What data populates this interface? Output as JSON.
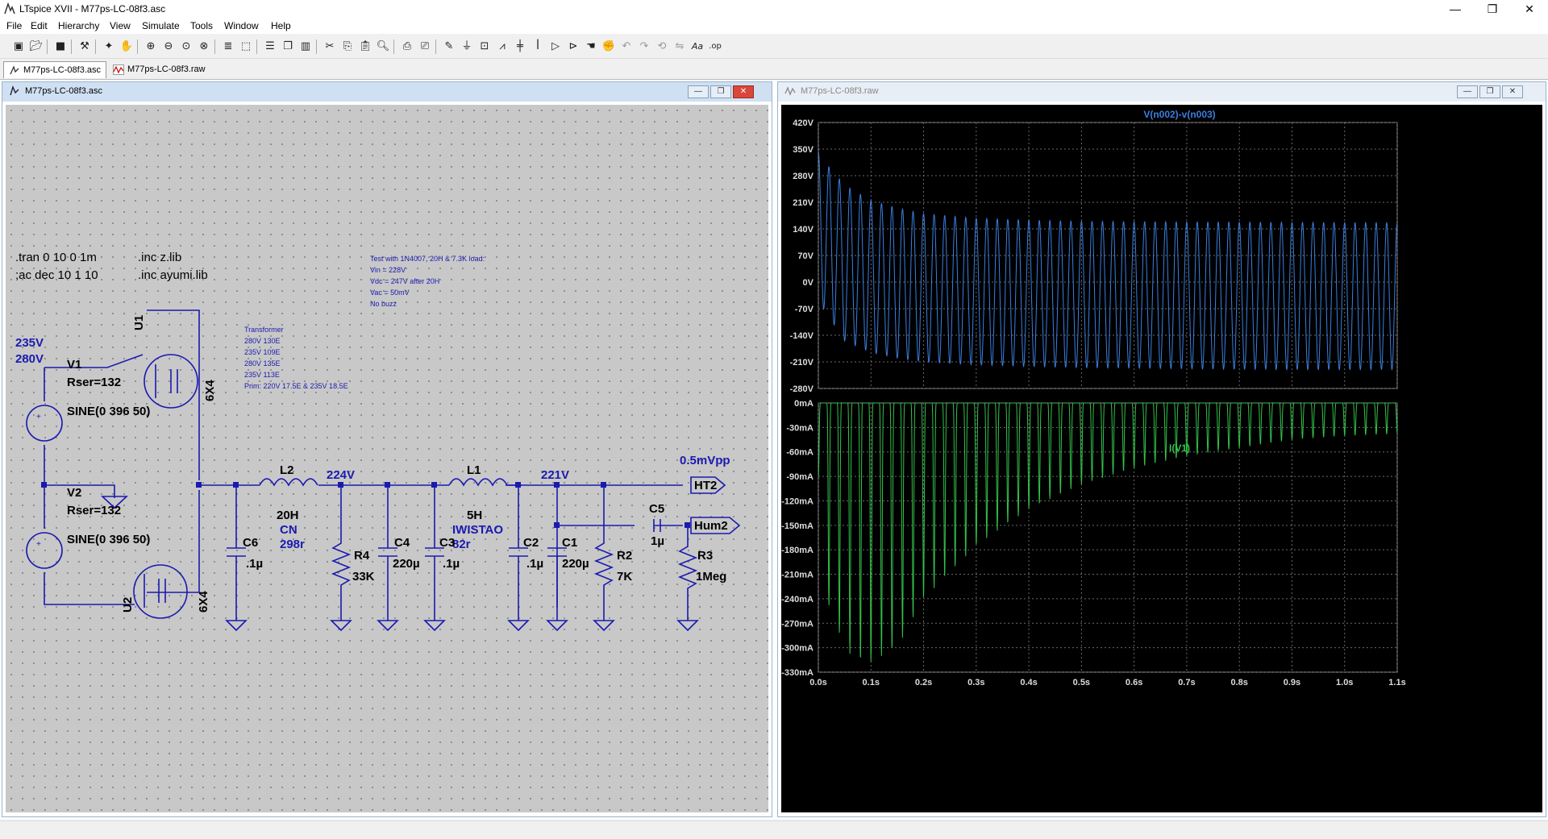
{
  "app": {
    "title": "LTspice XVII - M77ps-LC-08f3.asc"
  },
  "window_controls": {
    "minimize": "—",
    "maximize": "❐",
    "close": "✕"
  },
  "menu": [
    "File",
    "Edit",
    "Hierarchy",
    "View",
    "Simulate",
    "Tools",
    "Window",
    "Help"
  ],
  "toolbar_icons": [
    "new-schematic-icon",
    "open-icon",
    "save-icon",
    "control-panel-icon",
    "run-icon",
    "halt-icon",
    "zoom-in-icon",
    "zoom-out-icon",
    "zoom-fit-icon",
    "zoom-cancel-icon",
    "autorange-icon",
    "zoom-back-icon",
    "tile-horizontal-icon",
    "cascade-icon",
    "tile-vertical-icon",
    "cut-icon",
    "copy-icon",
    "paste-icon",
    "find-icon",
    "print-icon",
    "print-preview-icon",
    "wire-icon",
    "ground-icon",
    "label-net-icon",
    "resistor-icon",
    "capacitor-icon",
    "inductor-icon",
    "diode-icon",
    "component-icon",
    "move-icon",
    "drag-icon",
    "undo-icon",
    "redo-icon",
    "rotate-icon",
    "mirror-icon",
    "text-icon",
    "spice-directive-icon"
  ],
  "tabs": [
    {
      "label": "M77ps-LC-08f3.asc",
      "icon": "schematic-icon"
    },
    {
      "label": "M77ps-LC-08f3.raw",
      "icon": "waveform-icon"
    }
  ],
  "schematic_window": {
    "title": "M77ps-LC-08f3.asc",
    "directives": [
      ".tran 0 10 0 1m",
      ";ac dec 10 1 10",
      ".inc z.lib",
      ".inc ayumi.lib"
    ],
    "note_test": [
      "Test with 1N4007, 20H & 7.3K load:",
      "Vin = 228V",
      "Vdc = 247V after 20H",
      "Vac = 50mV",
      "No buzz"
    ],
    "note_transformer": [
      "Transformer",
      "280V 130E",
      "235V 109E",
      "280V 135E",
      "235V 113E",
      "Prim: 220V 17.5E & 235V 18.5E"
    ],
    "v_labels": [
      "235V",
      "280V"
    ],
    "components": {
      "v1": {
        "name": "V1",
        "rser": "Rser=132",
        "value": "SINE(0 396 50)"
      },
      "v2": {
        "name": "V2",
        "rser": "Rser=132",
        "value": "SINE(0 396 50)"
      },
      "u1": {
        "name": "U1",
        "part": "6X4"
      },
      "u2": {
        "name": "U2",
        "part": "6X4"
      },
      "l2": {
        "name": "L2",
        "value": "20H",
        "extra1": "CN",
        "extra2": "298r"
      },
      "l1": {
        "name": "L1",
        "value": "5H",
        "extra1": "IWISTAO",
        "extra2": "82r"
      },
      "c6": {
        "name": "C6",
        "value": ".1µ"
      },
      "r4": {
        "name": "R4",
        "value": "33K"
      },
      "c4": {
        "name": "C4",
        "value": "220µ"
      },
      "c3": {
        "name": "C3",
        "value": ".1µ"
      },
      "c2": {
        "name": "C2",
        "value": ".1µ"
      },
      "c1": {
        "name": "C1",
        "value": "220µ"
      },
      "r2": {
        "name": "R2",
        "value": "7K"
      },
      "c5": {
        "name": "C5",
        "value": "1µ"
      },
      "r3": {
        "name": "R3",
        "value": "1Meg"
      }
    },
    "node_voltages": {
      "after_l2": "224V",
      "after_l1": "221V",
      "ripple": "0.5mVpp"
    },
    "net_labels": {
      "ht2": "HT2",
      "hum2": "Hum2"
    }
  },
  "waveform_window": {
    "title": "M77ps-LC-08f3.raw",
    "top_plot": {
      "trace_name": "V(n002)-v(n003)",
      "color": "#3a7fe0",
      "y_ticks": [
        "420V",
        "350V",
        "280V",
        "210V",
        "140V",
        "70V",
        "0V",
        "-70V",
        "-140V",
        "-210V",
        "-280V"
      ]
    },
    "bottom_plot": {
      "trace_name": "I(V1)",
      "color": "#33c24a",
      "y_ticks": [
        "0mA",
        "-30mA",
        "-60mA",
        "-90mA",
        "-120mA",
        "-150mA",
        "-180mA",
        "-210mA",
        "-240mA",
        "-270mA",
        "-300mA",
        "-330mA"
      ]
    },
    "x_ticks": [
      "0.0s",
      "0.1s",
      "0.2s",
      "0.3s",
      "0.4s",
      "0.5s",
      "0.6s",
      "0.7s",
      "0.8s",
      "0.9s",
      "1.0s",
      "1.1s"
    ]
  },
  "chart_data": [
    {
      "type": "line",
      "title": "V(n002)-v(n003)",
      "xlabel": "",
      "ylabel": "",
      "xlim": [
        0,
        1.1
      ],
      "ylim": [
        -280,
        420
      ],
      "grid": true,
      "series": [
        {
          "name": "V(n002)-v(n003)",
          "frequency_hz": 50,
          "x": [
            0.0,
            0.01,
            0.05,
            0.1,
            0.15,
            0.2,
            0.3,
            0.4,
            0.5,
            0.7,
            0.9,
            1.1
          ],
          "y_max": [
            345,
            320,
            255,
            215,
            195,
            180,
            168,
            163,
            160,
            158,
            157,
            156
          ],
          "y_min": [
            -30,
            -70,
            -155,
            -185,
            -200,
            -210,
            -218,
            -222,
            -225,
            -228,
            -230,
            -230
          ]
        }
      ]
    },
    {
      "type": "line",
      "title": "I(V1)",
      "xlabel": "",
      "ylabel": "",
      "xlim": [
        0,
        1.1
      ],
      "ylim": [
        -330,
        0
      ],
      "grid": true,
      "series": [
        {
          "name": "I(V1)",
          "frequency_hz": 50,
          "x": [
            0.0,
            0.02,
            0.05,
            0.07,
            0.1,
            0.15,
            0.2,
            0.3,
            0.4,
            0.5,
            0.6,
            0.7,
            0.8,
            0.9,
            1.0,
            1.1
          ],
          "y_peak": [
            -90,
            -250,
            -300,
            -315,
            -318,
            -300,
            -240,
            -175,
            -130,
            -100,
            -80,
            -65,
            -55,
            -45,
            -40,
            -38
          ],
          "y_base": [
            0,
            0,
            0,
            0,
            0,
            0,
            0,
            0,
            0,
            0,
            0,
            0,
            0,
            0,
            0,
            0
          ]
        }
      ]
    }
  ]
}
